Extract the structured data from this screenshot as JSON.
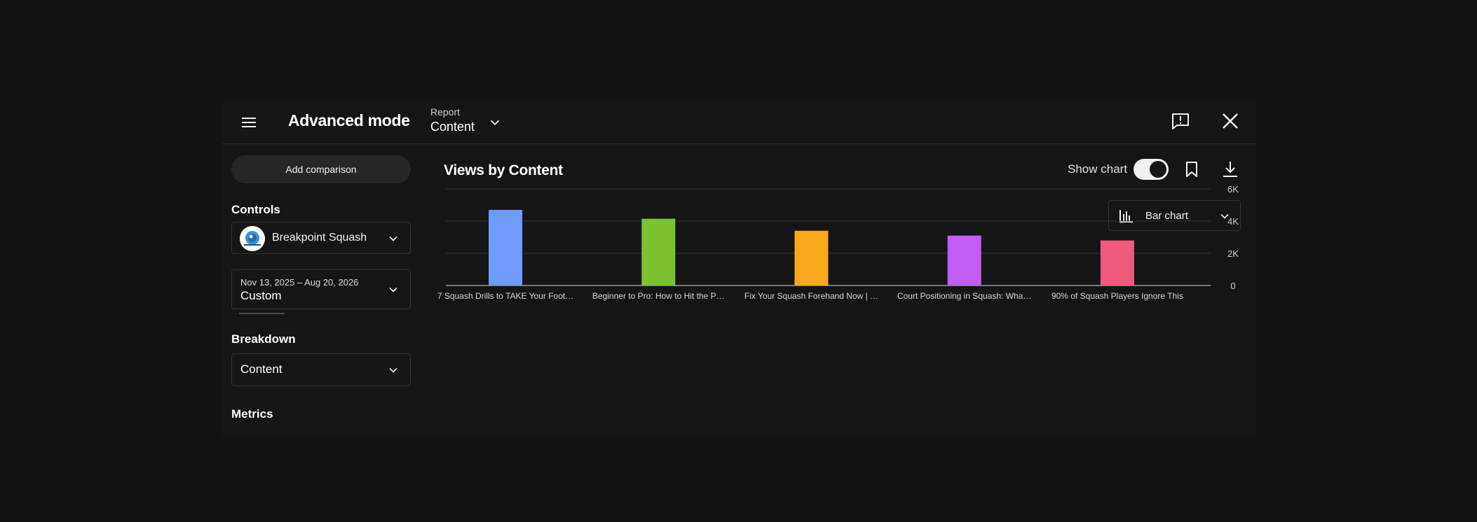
{
  "header": {
    "mode_title": "Advanced mode",
    "report_label": "Report",
    "report_value": "Content"
  },
  "sidebar": {
    "add_comparison": "Add comparison",
    "controls_label": "Controls",
    "channel_name": "Breakpoint Squash",
    "date_range": "Nov 13, 2025 – Aug 20, 2026",
    "date_type": "Custom",
    "breakdown_label": "Breakdown",
    "breakdown_value": "Content",
    "metrics_label": "Metrics"
  },
  "main": {
    "chart_title": "Views by Content",
    "show_chart_label": "Show chart",
    "show_chart_on": true,
    "chart_type_label": "Bar chart"
  },
  "icons": {
    "menu": "hamburger-icon",
    "report_dropdown": "chevron-down-icon",
    "feedback": "feedback-icon",
    "close": "close-icon",
    "bookmark": "bookmark-icon",
    "download": "download-icon",
    "chart_type": "bar-chart-icon"
  },
  "chart_data": {
    "type": "bar",
    "categories": [
      "7 Squash Drills to TAKE Your Foot…",
      "Beginner to Pro: How to Hit the P…",
      "Fix Your Squash Forehand Now | …",
      "Court Positioning in Squash: Wha…",
      "90% of Squash Players Ignore This"
    ],
    "values": [
      4700,
      4150,
      3400,
      3100,
      2800
    ],
    "colors": [
      "#6f9bff",
      "#7ac232",
      "#f7a81b",
      "#c35cf5",
      "#f05a7e"
    ],
    "y_ticks": [
      "0",
      "2K",
      "4K",
      "6K"
    ],
    "ylim": [
      0,
      6000
    ],
    "grid": true,
    "y_axis_side": "right"
  }
}
